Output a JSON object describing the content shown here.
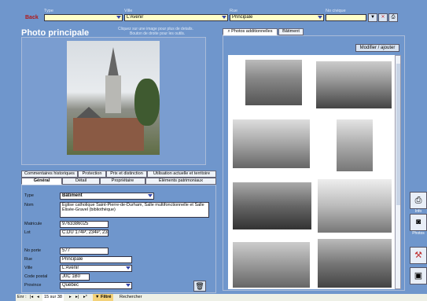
{
  "toolbar": {
    "back_label": "Back",
    "type_label": "Type",
    "type_value": "",
    "ville_label": "Ville",
    "ville_value": "L'Avenir",
    "rue_label": "Rue",
    "rue_value": "Principale",
    "no_civique_label": "No civique",
    "no_civique_value": ""
  },
  "photo_panel": {
    "title": "Photo principale",
    "hint_line1": "Cliquez sur une image pour plus de details.",
    "hint_line2": "Bouton de droite pour les outils."
  },
  "additional": {
    "tabs": [
      "Photos additionnelles",
      "Bâtiment"
    ],
    "modify_button": "Modifier / ajouter"
  },
  "info_tabs_row1": [
    "Commentaires historiques",
    "Protection",
    "Prix et distinction",
    "Utilisation actuelle et territoire"
  ],
  "info_tabs_row2": [
    "Général",
    "Détail",
    "Propriétaire",
    "Éléments patrimoniaux"
  ],
  "form": {
    "type_label": "Type",
    "type_value": "Bâtiment",
    "nom_label": "Nom",
    "nom_value": "Église catholique Saint-Pierre-de-Durham, Salle multifonctionnelle et Salle Élisée-Gravel (bibliothèque)",
    "matricule_label": "Matricule",
    "matricule_value": "9763386025",
    "lot_label": "Lot",
    "lot_value": "C.DU 174P; 234P; 235",
    "noporte_label": "No porte",
    "noporte_value": "577",
    "rue_label": "Rue",
    "rue_value": "Principale",
    "ville_label": "Ville",
    "ville_value": "L'Avenir",
    "codepostal_label": "Code postal",
    "codepostal_value": "J0C 1B0",
    "province_label": "Province",
    "province_value": "Québec"
  },
  "side_buttons": [
    "Info",
    "Photos"
  ],
  "statusbar": {
    "record_label": "Enr :",
    "record_value": "15 sur 38",
    "filter_label": "Filtré",
    "search_label": "Rechercher"
  },
  "colors": {
    "background": "#6f96cc",
    "accent_red": "#c03030"
  }
}
